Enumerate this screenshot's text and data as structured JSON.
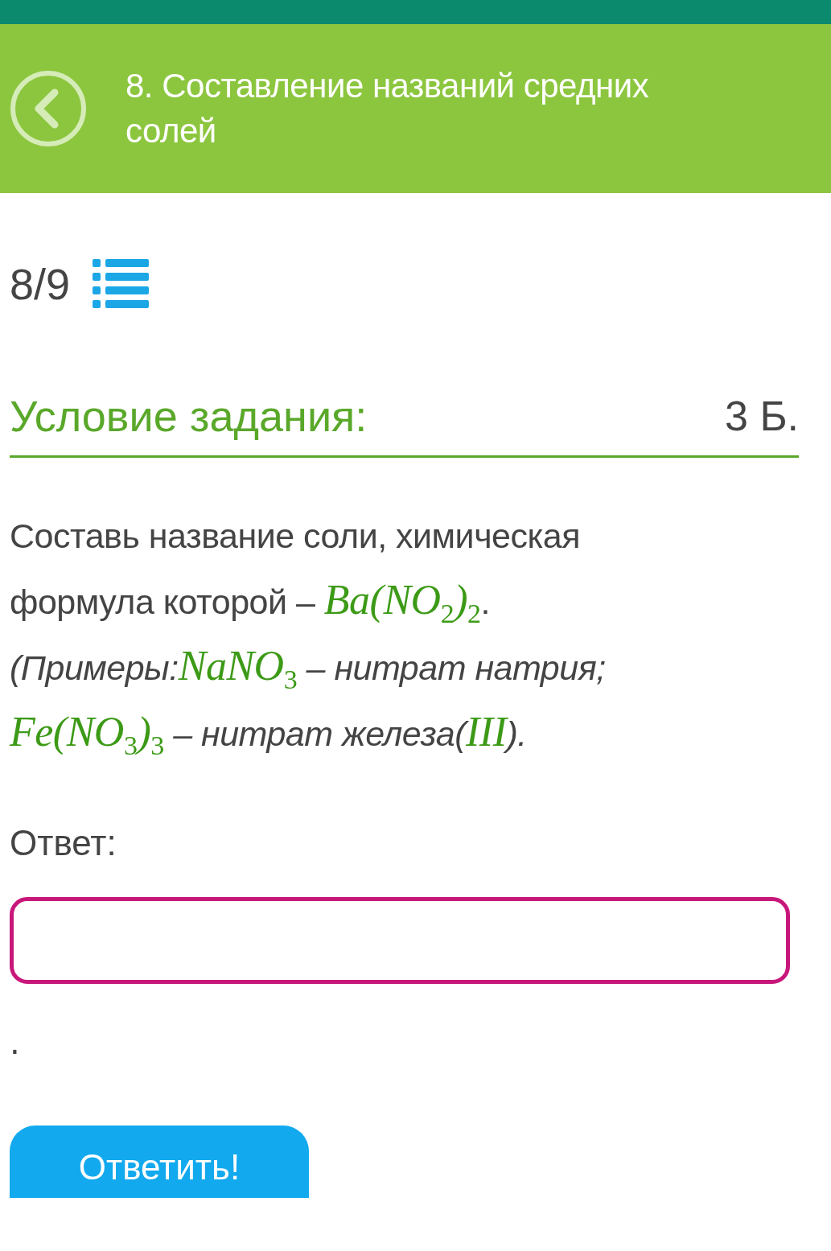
{
  "header": {
    "title": "8. Составление названий средних солей"
  },
  "progress": {
    "counter": "8/9"
  },
  "task": {
    "heading": "Условие задания:",
    "points": "3 Б.",
    "segments": [
      {
        "kind": "text",
        "text": "Составь название соли, химическая формула которой – "
      },
      {
        "kind": "formula",
        "text": "Ba(NO$_{2}$)$_{2}$"
      },
      {
        "kind": "text",
        "text": "."
      },
      {
        "kind": "italic",
        "text": " (Примеры:"
      },
      {
        "kind": "formula",
        "text": "NaNO$_{3}$"
      },
      {
        "kind": "italic",
        "text": " – нитрат натрия; "
      },
      {
        "kind": "formula",
        "text": "Fe(NO$_{3}$)$_{3}$"
      },
      {
        "kind": "italic",
        "text": " – нитрат железа("
      },
      {
        "kind": "formula",
        "text": "III"
      },
      {
        "kind": "italic",
        "text": ")."
      }
    ]
  },
  "answer": {
    "label": "Ответ:",
    "after": "."
  },
  "submit": {
    "label": "Ответить!"
  }
}
